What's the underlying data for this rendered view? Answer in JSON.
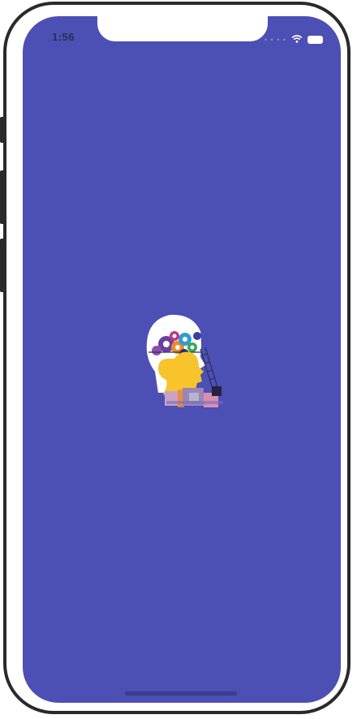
{
  "status_bar": {
    "time": "1:56",
    "signal_icon": "cellular-signal-icon",
    "wifi_icon": "wifi-icon",
    "battery_icon": "battery-icon"
  },
  "splash": {
    "logo_icon": "head-with-gears-logo"
  },
  "colors": {
    "background": "#4c4fb3",
    "logo_head_yellow": "#f7c42c",
    "logo_face_white": "#ffffff"
  }
}
